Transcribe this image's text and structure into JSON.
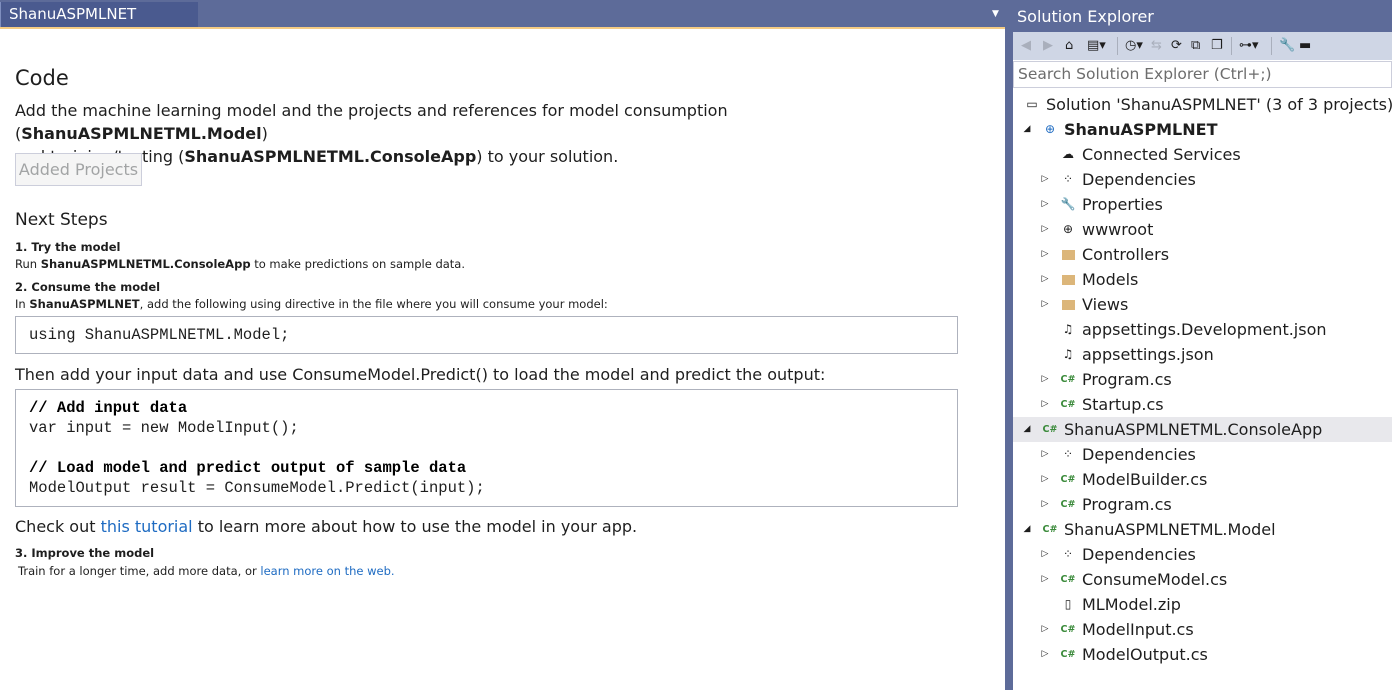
{
  "doc_tab": {
    "title": "ShanuASPMLNET"
  },
  "code_section": {
    "heading": "Code",
    "intro_1": "Add the machine learning model and the projects and references for model consumption (",
    "model_project": "ShanuASPMLNETML.Model",
    "intro_2": ")",
    "intro_3": "and training/testing (",
    "console_project": "ShanuASPMLNETML.ConsoleApp",
    "intro_4": ") to your solution.",
    "added_button": "Added Projects"
  },
  "next_steps": {
    "heading": "Next Steps",
    "step1_title": "1. Try the model",
    "step1_pre": "Run ",
    "step1_bold": "ShanuASPMLNETML.ConsoleApp",
    "step1_post": " to make predictions on sample data.",
    "step2_title": "2. Consume the model",
    "step2_pre": "In ",
    "step2_bold": "ShanuASPMLNET",
    "step2_post": ", add the following using directive in the file where you will consume your model:",
    "using_code": "using ShanuASPMLNETML.Model;",
    "then_text": "Then add your input data and use ConsumeModel.Predict() to load the model and predict the output:",
    "code_lines": [
      "// Add input data",
      "var input = new ModelInput();",
      "",
      "// Load model and predict output of sample data",
      "ModelOutput result = ConsumeModel.Predict(input);"
    ],
    "checkout_pre": "Check out ",
    "checkout_link": "this tutorial",
    "checkout_post": " to learn more about how to use the model in your app.",
    "step3_title": "3. Improve the model",
    "step3_pre": "Train for a longer time, add more data, or ",
    "step3_link": "learn more on the web."
  },
  "solution_explorer": {
    "title": "Solution Explorer",
    "search_placeholder": "Search Solution Explorer (Ctrl+;)",
    "tree": [
      {
        "label": "Solution 'ShanuASPMLNET' (3 of 3 projects)",
        "icon": "solution-icon"
      },
      {
        "label": "ShanuASPMLNET",
        "icon": "web-project-icon"
      },
      {
        "label": "Connected Services",
        "icon": "connected-services-icon"
      },
      {
        "label": "Dependencies",
        "icon": "dependencies-icon"
      },
      {
        "label": "Properties",
        "icon": "wrench-icon"
      },
      {
        "label": "wwwroot",
        "icon": "globe-icon"
      },
      {
        "label": "Controllers",
        "icon": "folder-icon"
      },
      {
        "label": "Models",
        "icon": "folder-icon"
      },
      {
        "label": "Views",
        "icon": "folder-icon"
      },
      {
        "label": "appsettings.Development.json",
        "icon": "json-file-icon"
      },
      {
        "label": "appsettings.json",
        "icon": "json-file-icon"
      },
      {
        "label": "Program.cs",
        "icon": "csharp-file-icon"
      },
      {
        "label": "Startup.cs",
        "icon": "csharp-file-icon"
      },
      {
        "label": "ShanuASPMLNETML.ConsoleApp",
        "icon": "csharp-project-icon"
      },
      {
        "label": "Dependencies",
        "icon": "dependencies-icon"
      },
      {
        "label": "ModelBuilder.cs",
        "icon": "csharp-file-icon"
      },
      {
        "label": "Program.cs",
        "icon": "csharp-file-icon"
      },
      {
        "label": "ShanuASPMLNETML.Model",
        "icon": "csharp-project-icon"
      },
      {
        "label": "Dependencies",
        "icon": "dependencies-icon"
      },
      {
        "label": "ConsumeModel.cs",
        "icon": "csharp-file-icon"
      },
      {
        "label": "MLModel.zip",
        "icon": "file-icon"
      },
      {
        "label": "ModelInput.cs",
        "icon": "csharp-file-icon"
      },
      {
        "label": "ModelOutput.cs",
        "icon": "csharp-file-icon"
      }
    ]
  },
  "colors": {
    "chrome": "#5d6b99",
    "accent": "#f5cc84",
    "link": "#1e6bc2"
  }
}
